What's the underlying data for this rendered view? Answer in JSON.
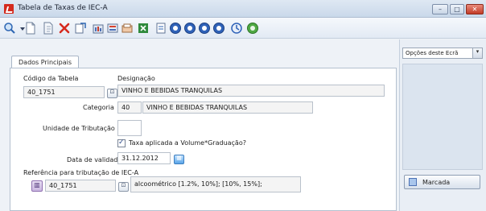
{
  "window": {
    "title": "Tabela de Taxas de IEC-A",
    "controls": {
      "minimize": "–",
      "maximize": "□",
      "close": "✕"
    }
  },
  "toolbar": {
    "icons": [
      "search-icon",
      "dropdown-arrow-icon",
      "new-document-icon",
      "copy-document-icon",
      "delete-icon",
      "print-preview-icon",
      "report-icon",
      "import-icon",
      "export-icon",
      "excel-icon",
      "page-icon",
      "first-record-icon",
      "previous-record-icon",
      "next-record-icon",
      "last-record-icon",
      "refresh-icon",
      "help-icon"
    ]
  },
  "tabs": [
    {
      "label": "Dados Principais"
    }
  ],
  "form": {
    "codigo_label": "Código da Tabela",
    "codigo_value": "40_1751",
    "designacao_label": "Designação",
    "designacao_value": "VINHO E BEBIDAS TRANQUILAS",
    "categoria_label": "Categoria",
    "categoria_code": "40",
    "categoria_value": "VINHO E BEBIDAS TRANQUILAS",
    "unidade_label": "Unidade de Tributação",
    "unidade_value": "",
    "taxa_label": "Taxa aplicada a Volume*Graduação?",
    "taxa_checked": true,
    "validade_label": "Data de validade",
    "validade_value": "31.12.2012",
    "referencia_label": "Referência para tributação de IEC-A",
    "referencia_code": "40_1751",
    "referencia_value": "alcoométrico [1.2%, 10%]; [10%, 15%];"
  },
  "side_panel": {
    "options_label": "Opções deste Ecrã",
    "marcada_label": "Marcada"
  },
  "colors": {
    "accent": "#d42b1e",
    "frame": "#c9d8ea"
  }
}
